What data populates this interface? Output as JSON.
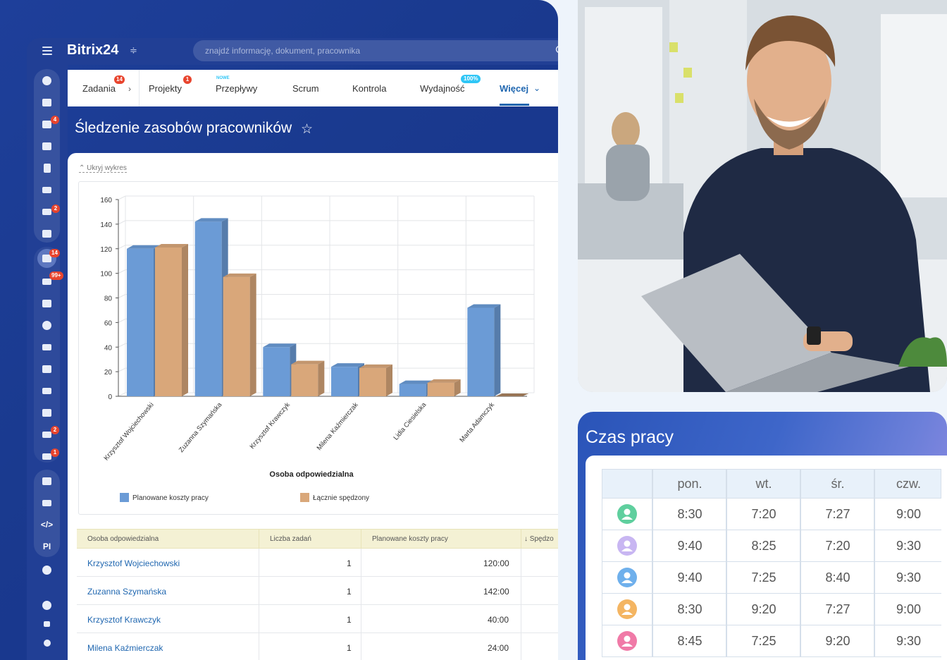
{
  "app": {
    "logo": "Bitrix24"
  },
  "search": {
    "placeholder": "znajdź informację, dokument, pracownika"
  },
  "sidebar": {
    "badges": [
      "4",
      "2",
      "14",
      "99+",
      "2",
      "1"
    ],
    "pi_label": "PI"
  },
  "tabs": [
    {
      "label": "Zadania",
      "badge": "14"
    },
    {
      "label": "Projekty",
      "badge": "1"
    },
    {
      "label": "Przepływy",
      "tag": "NOWE"
    },
    {
      "label": "Scrum"
    },
    {
      "label": "Kontrola"
    },
    {
      "label": "Wydajność",
      "badge": "100%"
    },
    {
      "label": "Więcej"
    }
  ],
  "page": {
    "title": "Śledzenie zasobów pracowników"
  },
  "chart_toggle": {
    "label": "⌃ Ukryj wykres"
  },
  "chart_data": {
    "type": "bar",
    "categories": [
      "Krzysztof Wojciechowski",
      "Zuzanna Szymańska",
      "Krzysztof Krawczyk",
      "Milena Kaźmierczak",
      "Lidia Ciesielska",
      "Marta Adamczyk"
    ],
    "series": [
      {
        "name": "Planowane koszty pracy",
        "values": [
          120,
          142,
          40,
          24,
          10,
          72
        ],
        "color": "#6b9bd6"
      },
      {
        "name": "Łącznie spędzony",
        "values": [
          121,
          97,
          26,
          23,
          11,
          0
        ],
        "color": "#d9a77a"
      }
    ],
    "xlabel": "Osoba odpowiedzialna",
    "ylim": [
      0,
      160
    ],
    "yticks": [
      0,
      20,
      40,
      60,
      80,
      100,
      120,
      140,
      160
    ],
    "grid": true,
    "legend": "bottom"
  },
  "table": {
    "headers": [
      "Osoba odpowiedzialna",
      "Liczba zadań",
      "Planowane koszty pracy",
      "↓ Spędzo"
    ],
    "rows": [
      [
        "Krzysztof Wojciechowski",
        "1",
        "120:00"
      ],
      [
        "Zuzanna Szymańska",
        "1",
        "142:00"
      ],
      [
        "Krzysztof Krawczyk",
        "1",
        "40:00"
      ],
      [
        "Milena Kaźmierczak",
        "1",
        "24:00"
      ]
    ]
  },
  "worktime": {
    "title": "Czas pracy",
    "days": [
      "pon.",
      "wt.",
      "śr.",
      "czw."
    ],
    "rows": [
      {
        "avatar_color": "#5fcf9e",
        "times": [
          "8:30",
          "7:20",
          "7:27",
          "9:00"
        ]
      },
      {
        "avatar_color": "#c8b6f2",
        "times": [
          "9:40",
          "8:25",
          "7:20",
          "9:30"
        ]
      },
      {
        "avatar_color": "#6fb0ec",
        "times": [
          "9:40",
          "7:25",
          "8:40",
          "9:30"
        ]
      },
      {
        "avatar_color": "#f4b562",
        "times": [
          "8:30",
          "9:20",
          "7:27",
          "9:00"
        ]
      },
      {
        "avatar_color": "#f07aa7",
        "times": [
          "8:45",
          "7:25",
          "9:20",
          "9:30"
        ]
      }
    ]
  }
}
